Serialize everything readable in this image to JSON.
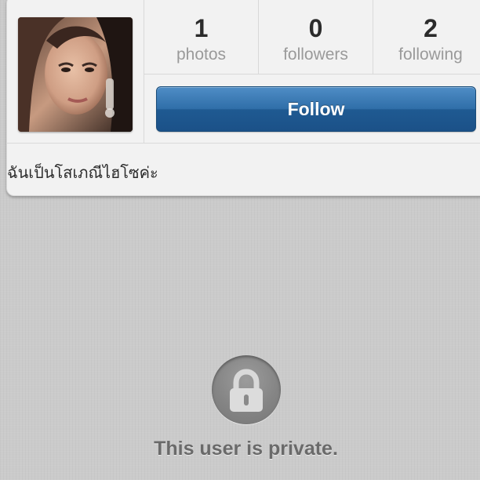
{
  "profile": {
    "avatar_alt": "profile photo",
    "bio": "ฉันเป็นโสเภณีไฮโซค่ะ"
  },
  "stats": [
    {
      "count": "1",
      "label": "photos"
    },
    {
      "count": "0",
      "label": "followers"
    },
    {
      "count": "2",
      "label": "following"
    }
  ],
  "follow_button": {
    "label": "Follow",
    "color": "#2f6ea8"
  },
  "private_notice": {
    "icon": "lock-icon",
    "message": "This user is private."
  }
}
